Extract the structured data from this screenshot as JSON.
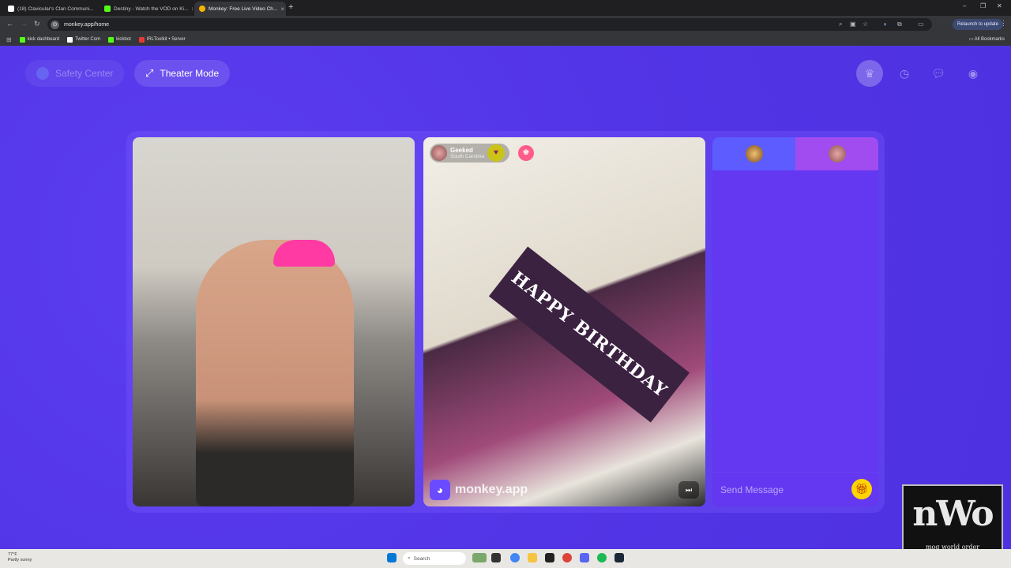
{
  "browser": {
    "tabs": [
      {
        "label": "(18) Clavicular's Clan Communi...",
        "favicon_color": "#ffffff",
        "active": false
      },
      {
        "label": "Destiny - Watch the VOD on Ki...",
        "favicon_color": "#53fc18",
        "active": false
      },
      {
        "label": "Monkey: Free Live Video Ch...",
        "favicon_color": "#f4b400",
        "active": true
      }
    ],
    "url": "monkey.app/home",
    "relaunch_label": "Relaunch to update",
    "bookmarks": [
      {
        "label": "kick dashboard",
        "icon_color": "#53fc18"
      },
      {
        "label": "Twitter Com",
        "icon_color": "#ffffff"
      },
      {
        "label": "kickbot",
        "icon_color": "#53fc18"
      },
      {
        "label": "IRLToolkit • Server",
        "icon_color": "#e53935"
      }
    ],
    "all_bookmarks_label": "All Bookmarks"
  },
  "app": {
    "safety_center_label": "Safety Center",
    "theater_mode_label": "Theater Mode",
    "top_icons": [
      "crown-icon",
      "history-icon",
      "chat-bubble-icon",
      "avatar-icon"
    ],
    "remote_user": {
      "name": "Geeked",
      "location": "South Carolina"
    },
    "banner_text": "HAPPY BIRTHDAY",
    "watermark_text": "monkey.app",
    "chat": {
      "placeholder": "Send Message"
    }
  },
  "overlay": {
    "logo_text": "nWo",
    "logo_subtext": "mog world order"
  },
  "taskbar": {
    "weather_temp": "77°F",
    "weather_desc": "Partly sunny",
    "search_placeholder": "Search"
  },
  "colors": {
    "app_bg": "#5235e6",
    "chat_bg": "#6338f0",
    "gift_yellow": "#ffd400"
  }
}
